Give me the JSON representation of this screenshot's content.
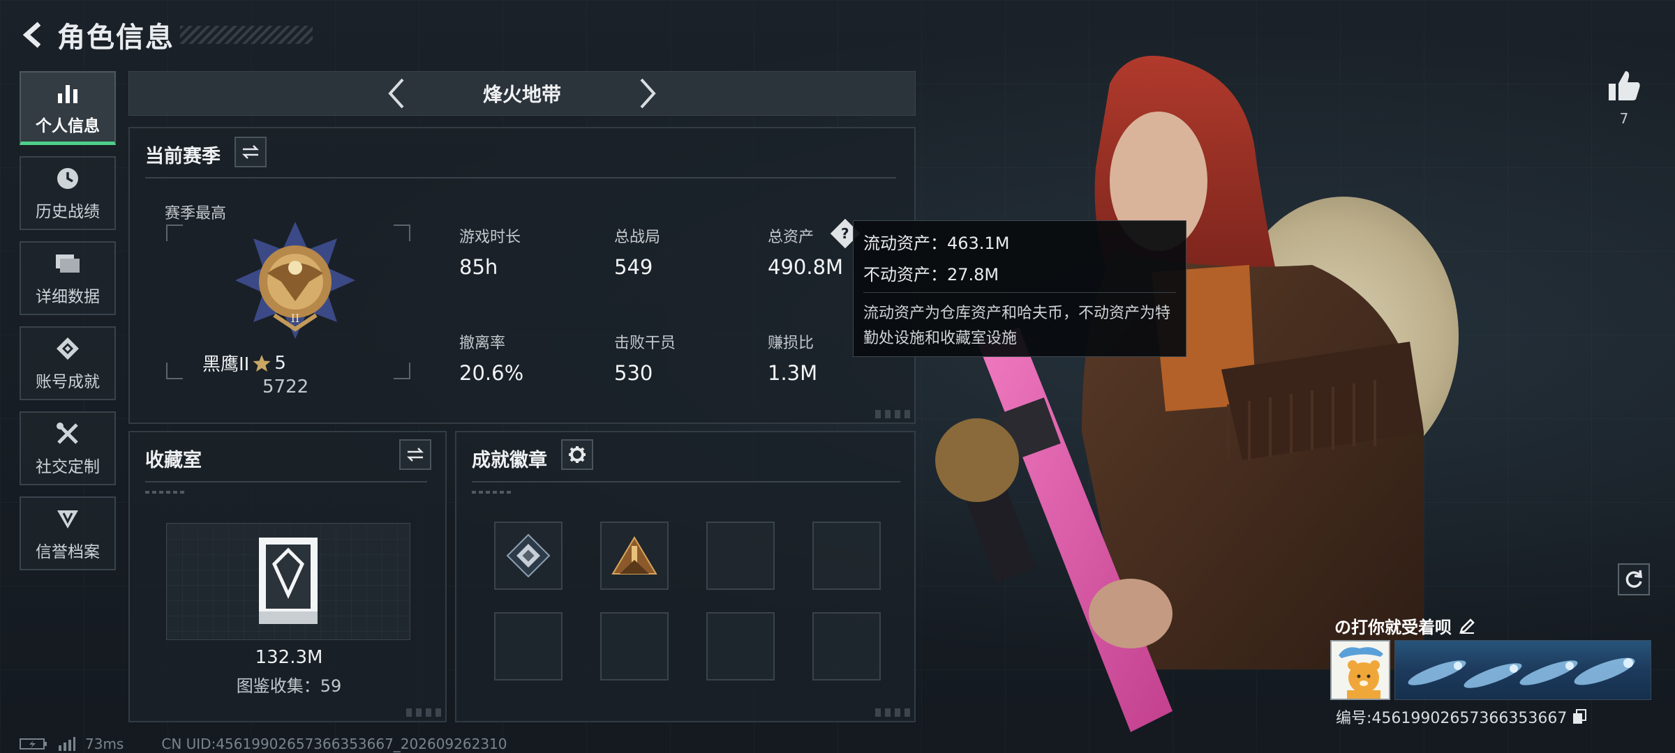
{
  "header": {
    "title": "角色信息"
  },
  "sidebar": {
    "items": [
      {
        "label": "个人信息",
        "icon": "bar-chart-icon",
        "active": true
      },
      {
        "label": "历史战绩",
        "icon": "history-icon"
      },
      {
        "label": "详细数据",
        "icon": "folders-icon"
      },
      {
        "label": "账号成就",
        "icon": "achievement-icon"
      },
      {
        "label": "社交定制",
        "icon": "tools-icon"
      },
      {
        "label": "信誉档案",
        "icon": "reputation-icon"
      }
    ]
  },
  "mode": {
    "current": "烽火地带"
  },
  "season": {
    "title": "当前赛季",
    "subtitle": "赛季最高",
    "rank": {
      "name": "黑鹰II",
      "stars": "5",
      "score": "5722"
    },
    "stats": [
      {
        "key": "游戏时长",
        "value": "85h"
      },
      {
        "key": "总战局",
        "value": "549"
      },
      {
        "key": "总资产",
        "value": "490.8M"
      },
      {
        "key": "撤离率",
        "value": "20.6%"
      },
      {
        "key": "击败干员",
        "value": "530"
      },
      {
        "key": "赚损比",
        "value": "1.3M"
      }
    ],
    "help": "?"
  },
  "tooltip": {
    "liquid": "流动资产：463.1M",
    "fixed": "不动资产：27.8M",
    "desc": "流动资产为仓库资产和哈夫币，不动资产为特勤处设施和收藏室设施"
  },
  "collection": {
    "title": "收藏室",
    "value": "132.3M",
    "count": "图鉴收集：59"
  },
  "badges": {
    "title": "成就徽章",
    "filled": 2,
    "slots": 8
  },
  "likes": {
    "count": "7"
  },
  "player": {
    "name": "の打你就受着呗",
    "id": "编号:4561990265736635366​7"
  },
  "status": {
    "ping": "73ms",
    "uid": "CN UID:4561990265736635366​7_202609262310"
  },
  "colors": {
    "accent": "#4fd08a",
    "panel_border": "#333c44",
    "background": "#161c22"
  }
}
